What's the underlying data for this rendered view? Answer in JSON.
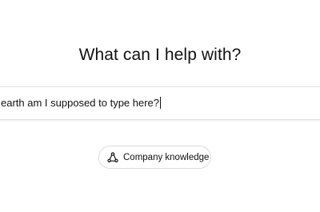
{
  "main": {
    "heading": "What can I help with?"
  },
  "composer": {
    "value": "earth am I supposed to type here?"
  },
  "suggestion_chip": {
    "label": "Company knowledge",
    "icon": "connectors-icon"
  },
  "colors": {
    "text": "#111111",
    "border": "#e3e3e3",
    "background": "#ffffff"
  }
}
